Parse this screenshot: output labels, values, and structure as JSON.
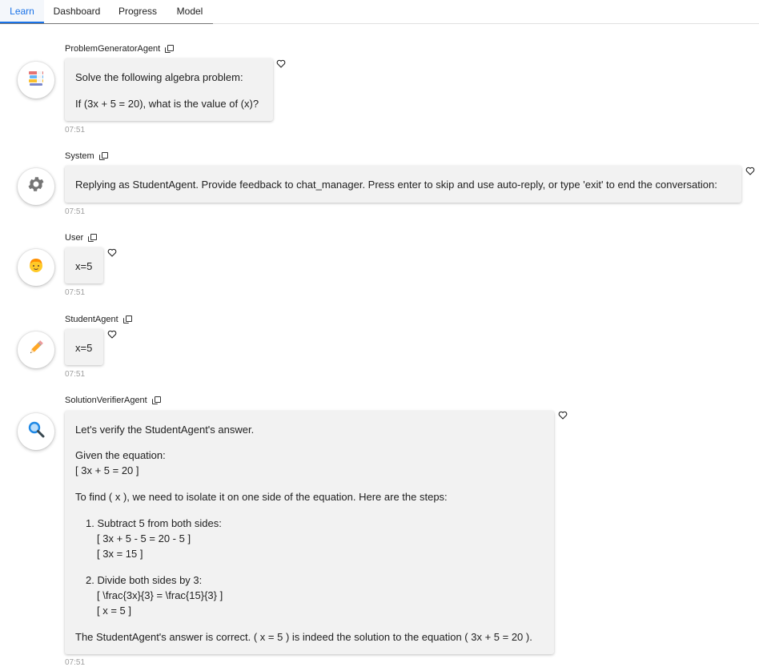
{
  "tabs": [
    {
      "label": "Learn",
      "active": true
    },
    {
      "label": "Dashboard",
      "active": false
    },
    {
      "label": "Progress",
      "active": false
    },
    {
      "label": "Model",
      "active": false
    }
  ],
  "messages": [
    {
      "sender": "ProblemGeneratorAgent",
      "avatar_icon": "books-icon",
      "lines": [
        "Solve the following algebra problem:",
        "If (3x + 5 = 20), what is the value of (x)?"
      ],
      "time": "07:51"
    },
    {
      "sender": "System",
      "avatar_icon": "gear-icon",
      "lines": [
        "Replying as StudentAgent. Provide feedback to chat_manager. Press enter to skip and use auto-reply, or type 'exit' to end the conversation:"
      ],
      "time": "07:51"
    },
    {
      "sender": "User",
      "avatar_icon": "child-face-icon",
      "lines": [
        "x=5"
      ],
      "time": "07:51"
    },
    {
      "sender": "StudentAgent",
      "avatar_icon": "pencil-icon",
      "lines": [
        "x=5"
      ],
      "time": "07:51"
    },
    {
      "sender": "SolutionVerifierAgent",
      "avatar_icon": "magnifier-icon",
      "intro": "Let's verify the StudentAgent's answer.",
      "given_label": "Given the equation:",
      "given_eq": "[ 3x + 5 = 20 ]",
      "find_text": "To find ( x ), we need to isolate it on one side of the equation. Here are the steps:",
      "steps": [
        {
          "title": "Subtract 5 from both sides:",
          "lines": [
            "[ 3x + 5 - 5 = 20 - 5 ]",
            "[ 3x = 15 ]"
          ]
        },
        {
          "title": "Divide both sides by 3:",
          "lines": [
            "[ \\frac{3x}{3} = \\frac{15}{3} ]",
            "[ x = 5 ]"
          ]
        }
      ],
      "conclusion": "The StudentAgent's answer is correct. ( x = 5 ) is indeed the solution to the equation ( 3x + 5 = 20 ).",
      "time": "07:51"
    }
  ]
}
